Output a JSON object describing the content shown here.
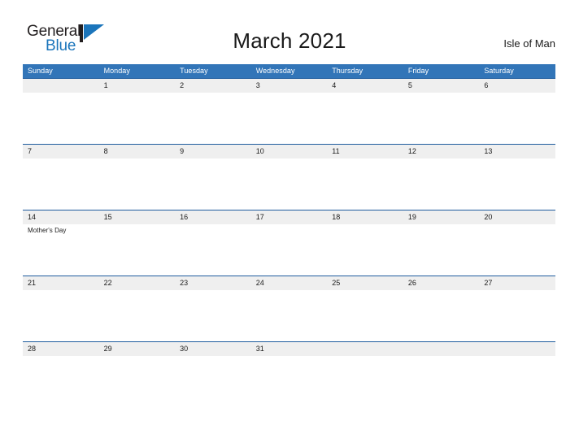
{
  "brand": {
    "name_part1": "General",
    "name_part2": "Blue",
    "flag_icon": "flag-triangle-icon",
    "accent_color": "#1b75bb",
    "text_color": "#231f20"
  },
  "header": {
    "title": "March 2021",
    "location": "Isle of Man"
  },
  "calendar": {
    "header_bg_color": "#3275b8",
    "row_rule_color": "#1f5c9e",
    "number_band_color": "#efefef",
    "weekdays": [
      "Sunday",
      "Monday",
      "Tuesday",
      "Wednesday",
      "Thursday",
      "Friday",
      "Saturday"
    ],
    "weeks": [
      [
        {
          "day": ""
        },
        {
          "day": "1"
        },
        {
          "day": "2"
        },
        {
          "day": "3"
        },
        {
          "day": "4"
        },
        {
          "day": "5"
        },
        {
          "day": "6"
        }
      ],
      [
        {
          "day": "7"
        },
        {
          "day": "8"
        },
        {
          "day": "9"
        },
        {
          "day": "10"
        },
        {
          "day": "11"
        },
        {
          "day": "12"
        },
        {
          "day": "13"
        }
      ],
      [
        {
          "day": "14",
          "event": "Mother's Day"
        },
        {
          "day": "15"
        },
        {
          "day": "16"
        },
        {
          "day": "17"
        },
        {
          "day": "18"
        },
        {
          "day": "19"
        },
        {
          "day": "20"
        }
      ],
      [
        {
          "day": "21"
        },
        {
          "day": "22"
        },
        {
          "day": "23"
        },
        {
          "day": "24"
        },
        {
          "day": "25"
        },
        {
          "day": "26"
        },
        {
          "day": "27"
        }
      ],
      [
        {
          "day": "28"
        },
        {
          "day": "29"
        },
        {
          "day": "30"
        },
        {
          "day": "31"
        },
        {
          "day": ""
        },
        {
          "day": ""
        },
        {
          "day": ""
        }
      ]
    ]
  }
}
